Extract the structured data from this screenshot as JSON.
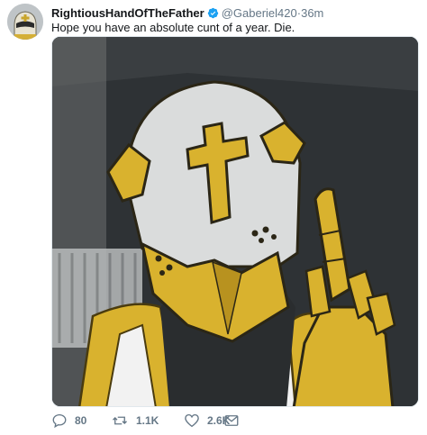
{
  "tweet": {
    "display_name": "RightiousHandOfTheFather",
    "handle": "@Gaberiel420",
    "separator": "·",
    "timestamp": "36m",
    "text": "Hope you have an absolute cunt of a year. Die.",
    "verified_icon": "verified-badge-icon",
    "avatar_icon": "helmet-avatar",
    "media_icon": "crusader-knight-drawing"
  },
  "actions": {
    "reply": {
      "icon": "reply-icon",
      "count": "80"
    },
    "retweet": {
      "icon": "retweet-icon",
      "count": "1.1K"
    },
    "like": {
      "icon": "heart-icon",
      "count": "2.6K"
    },
    "message": {
      "icon": "envelope-icon"
    }
  },
  "colors": {
    "verified": "#1da1f2",
    "secondary_text": "#657786",
    "primary_text": "#14171a",
    "armor_gold": "#d9b22e"
  }
}
